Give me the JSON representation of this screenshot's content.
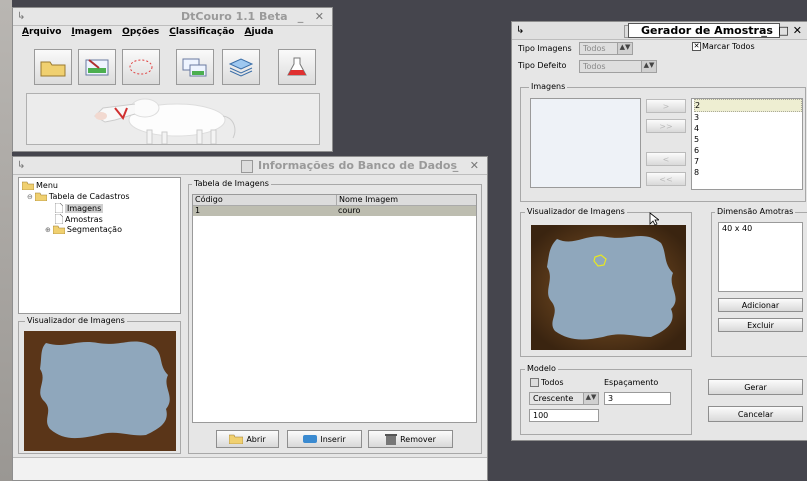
{
  "main_window": {
    "title": "DtCouro 1.1 Beta",
    "menu": [
      "Arquivo",
      "Imagem",
      "Opções",
      "Classificação",
      "Ajuda"
    ],
    "toolbar_icons": [
      "folder-icon",
      "image-edit-icon",
      "ellipse-select-icon",
      "images-icon",
      "database-icon",
      "flask-icon"
    ]
  },
  "db_window": {
    "title": "Informações do Banco de Dados",
    "tree": {
      "root": "Menu",
      "group": "Tabela de Cadastros",
      "items": [
        "Imagens",
        "Amostras",
        "Segmentação"
      ]
    },
    "viewer_label": "Visualizador de Imagens",
    "table_label": "Tabela de Imagens",
    "columns": [
      "Código",
      "Nome Imagem"
    ],
    "rows": [
      [
        "1",
        "couro"
      ]
    ],
    "buttons": {
      "open": "Abrir",
      "insert": "Inserir",
      "remove": "Remover"
    }
  },
  "sampler": {
    "title": "Gerador de Amostras",
    "tipo_imagens_label": "Tipo Imagens",
    "tipo_imagens_value": "Todos",
    "tipo_defeito_label": "Tipo Defeito",
    "tipo_defeito_value": "Todos",
    "marcar_todos": "Marcar Todos",
    "images_label": "Imagens",
    "move_buttons": [
      ">",
      ">>",
      "<",
      "<<"
    ],
    "image_numbers": [
      "2",
      "3",
      "4",
      "5",
      "6",
      "7",
      "8"
    ],
    "viewer_label": "Visualizador de Imagens",
    "dimensao_label": "Dimensão Amotras",
    "dimensao_items": [
      "40 x 40"
    ],
    "add_button": "Adicionar",
    "delete_button": "Excluir",
    "modelo_label": "Modelo",
    "todos_label": "Todos",
    "espacamento_label": "Espaçamento",
    "order_value": "Crescente",
    "espacamento_value": "3",
    "count_value": "100",
    "generate_button": "Gerar",
    "cancel_button": "Cancelar"
  }
}
